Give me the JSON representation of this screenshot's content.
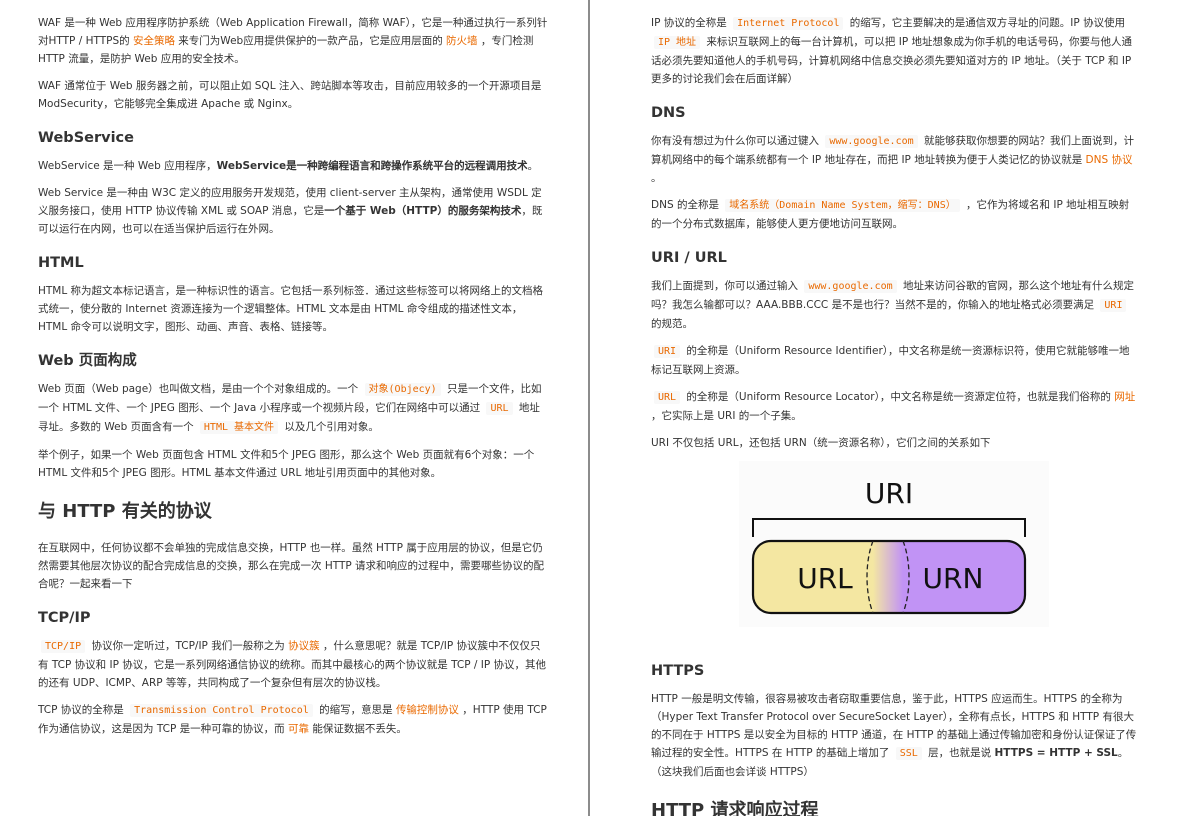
{
  "left": {
    "waf_p1": [
      "WAF 是一种 Web 应用程序防护系统（Web Application Firewall，简称 WAF），它是一种通过执行一系列针对HTTP / HTTPS的 ",
      "安全策略",
      " 来专门为Web应用提供保护的一款产品，它是应用层面的 ",
      "防火墙",
      " ，专门检测 HTTP 流量，是防护 Web 应用的安全技术。"
    ],
    "waf_p2": "WAF 通常位于 Web 服务器之前，可以阻止如 SQL 注入、跨站脚本等攻击，目前应用较多的一个开源项目是 ModSecurity，它能够完全集成进 Apache 或 Nginx。",
    "ws_title": "WebService",
    "ws_p1": [
      "WebService 是一种 Web 应用程序，",
      "WebService是一种跨编程语言和跨操作系统平台的远程调用技术",
      "。"
    ],
    "ws_p2": [
      "Web Service 是一种由 W3C 定义的应用服务开发规范，使用 client-server 主从架构，通常使用 WSDL 定义服务接口，使用 HTTP 协议传输 XML 或 SOAP 消息，它是",
      "一个基于 Web（HTTP）的服务架构技术",
      "，既可以运行在内网，也可以在适当保护后运行在外网。"
    ],
    "html_title": "HTML",
    "html_p": "HTML 称为超文本标记语言，是一种标识性的语言。它包括一系列标签．通过这些标签可以将网络上的文档格式统一，使分散的 Internet 资源连接为一个逻辑整体。HTML 文本是由 HTML 命令组成的描述性文本，HTML 命令可以说明文字，图形、动画、声音、表格、链接等。",
    "web_title": "Web 页面构成",
    "web_p1": [
      "Web 页面（Web page）也叫做文档，是由一个个对象组成的。一个 ",
      "对象(Objecy)",
      " 只是一个文件，比如一个 HTML 文件、一个 JPEG 图形、一个 Java 小程序或一个视频片段，它们在网络中可以通过 ",
      "URL",
      " 地址寻址。多数的 Web 页面含有一个 ",
      "HTML 基本文件",
      " 以及几个引用对象。"
    ],
    "web_p2": "举个例子，如果一个 Web 页面包含 HTML 文件和5个 JPEG 图形，那么这个 Web 页面就有6个对象：一个 HTML 文件和5个 JPEG 图形。HTML 基本文件通过 URL 地址引用页面中的其他对象。",
    "proto_title": "与 HTTP 有关的协议",
    "proto_p": "在互联网中，任何协议都不会单独的完成信息交换，HTTP 也一样。虽然 HTTP 属于应用层的协议，但是它仍然需要其他层次协议的配合完成信息的交换，那么在完成一次 HTTP 请求和响应的过程中，需要哪些协议的配合呢？一起来看一下",
    "tcp_title": "TCP/IP",
    "tcp_p1": [
      "TCP/IP",
      " 协议你一定听过，TCP/IP 我们一般称之为 ",
      "协议簇",
      " ，什么意思呢？就是 TCP/IP 协议簇中不仅仅只有 TCP 协议和 IP 协议，它是一系列网络通信协议的统称。而其中最核心的两个协议就是 TCP / IP 协议，其他的还有 UDP、ICMP、ARP 等等，共同构成了一个复杂但有层次的协议栈。"
    ],
    "tcp_p2": [
      "TCP 协议的全称是 ",
      "Transmission Control Protocol",
      " 的缩写，意思是 ",
      "传输控制协议",
      " ，HTTP 使用 TCP 作为通信协议，这是因为 TCP 是一种可靠的协议，而 ",
      "可靠",
      " 能保证数据不丢失。"
    ]
  },
  "right": {
    "ip_p": [
      "IP 协议的全称是 ",
      "Internet Protocol",
      " 的缩写，它主要解决的是通信双方寻址的问题。IP 协议使用 ",
      "IP 地址",
      " 来标识互联网上的每一台计算机，可以把 IP 地址想象成为你手机的电话号码，你要与他人通话必须先要知道他人的手机号码，计算机网络中信息交换必须先要知道对方的 IP 地址。（关于 TCP 和 IP 更多的讨论我们会在后面详解）"
    ],
    "dns_title": "DNS",
    "dns_p1": [
      "你有没有想过为什么你可以通过键入 ",
      "www.google.com",
      " 就能够获取你想要的网站？我们上面说到，计算机网络中的每个端系统都有一个 IP 地址存在，而把 IP 地址转换为便于人类记忆的协议就是 ",
      "DNS 协议",
      " 。"
    ],
    "dns_p2": [
      "DNS 的全称是 ",
      "域名系统（Domain Name System，缩写：DNS）",
      " ，它作为将域名和 IP 地址相互映射的一个分布式数据库，能够使人更方便地访问互联网。"
    ],
    "uri_title": "URI / URL",
    "uri_p1": [
      "我们上面提到，你可以通过输入 ",
      "www.google.com",
      " 地址来访问谷歌的官网，那么这个地址有什么规定吗？我怎么输都可以？AAA.BBB.CCC 是不是也行？当然不是的，你输入的地址格式必须要满足 ",
      "URI",
      " 的规范。"
    ],
    "uri_p2": [
      "URI",
      " 的全称是（Uniform Resource Identifier），中文名称是统一资源标识符，使用它就能够唯一地标记互联网上资源。"
    ],
    "uri_p3": [
      "URL",
      " 的全称是（Uniform Resource Locator），中文名称是统一资源定位符，也就是我们俗称的 ",
      "网址",
      " ，它实际上是 URI 的一个子集。"
    ],
    "uri_p4": "URI 不仅包括 URL，还包括 URN（统一资源名称），它们之间的关系如下",
    "diagram": {
      "uri_label": "URI",
      "url_label": "URL",
      "urn_label": "URN",
      "url_color": "#f4e7a2",
      "urn_color": "#c193f5"
    },
    "https_title": "HTTPS",
    "https_p": [
      "HTTP 一般是明文传输，很容易被攻击者窃取重要信息，鉴于此，HTTPS 应运而生。HTTPS 的全称为（Hyper Text Transfer Protocol over SecureSocket Layer），全称有点长，HTTPS 和 HTTP 有很大的不同在于 HTTPS 是以安全为目标的 HTTP 通道，在 HTTP 的基础上通过传输加密和身份认证保证了传输过程的安全性。HTTPS 在 HTTP 的基础上增加了 ",
      "SSL",
      " 层，也就是说 ",
      "HTTPS = HTTP + SSL",
      "。（这块我们后面也会详谈 HTTPS）"
    ],
    "flow_title": "HTTP 请求响应过程"
  },
  "accent_color": "#e96900"
}
